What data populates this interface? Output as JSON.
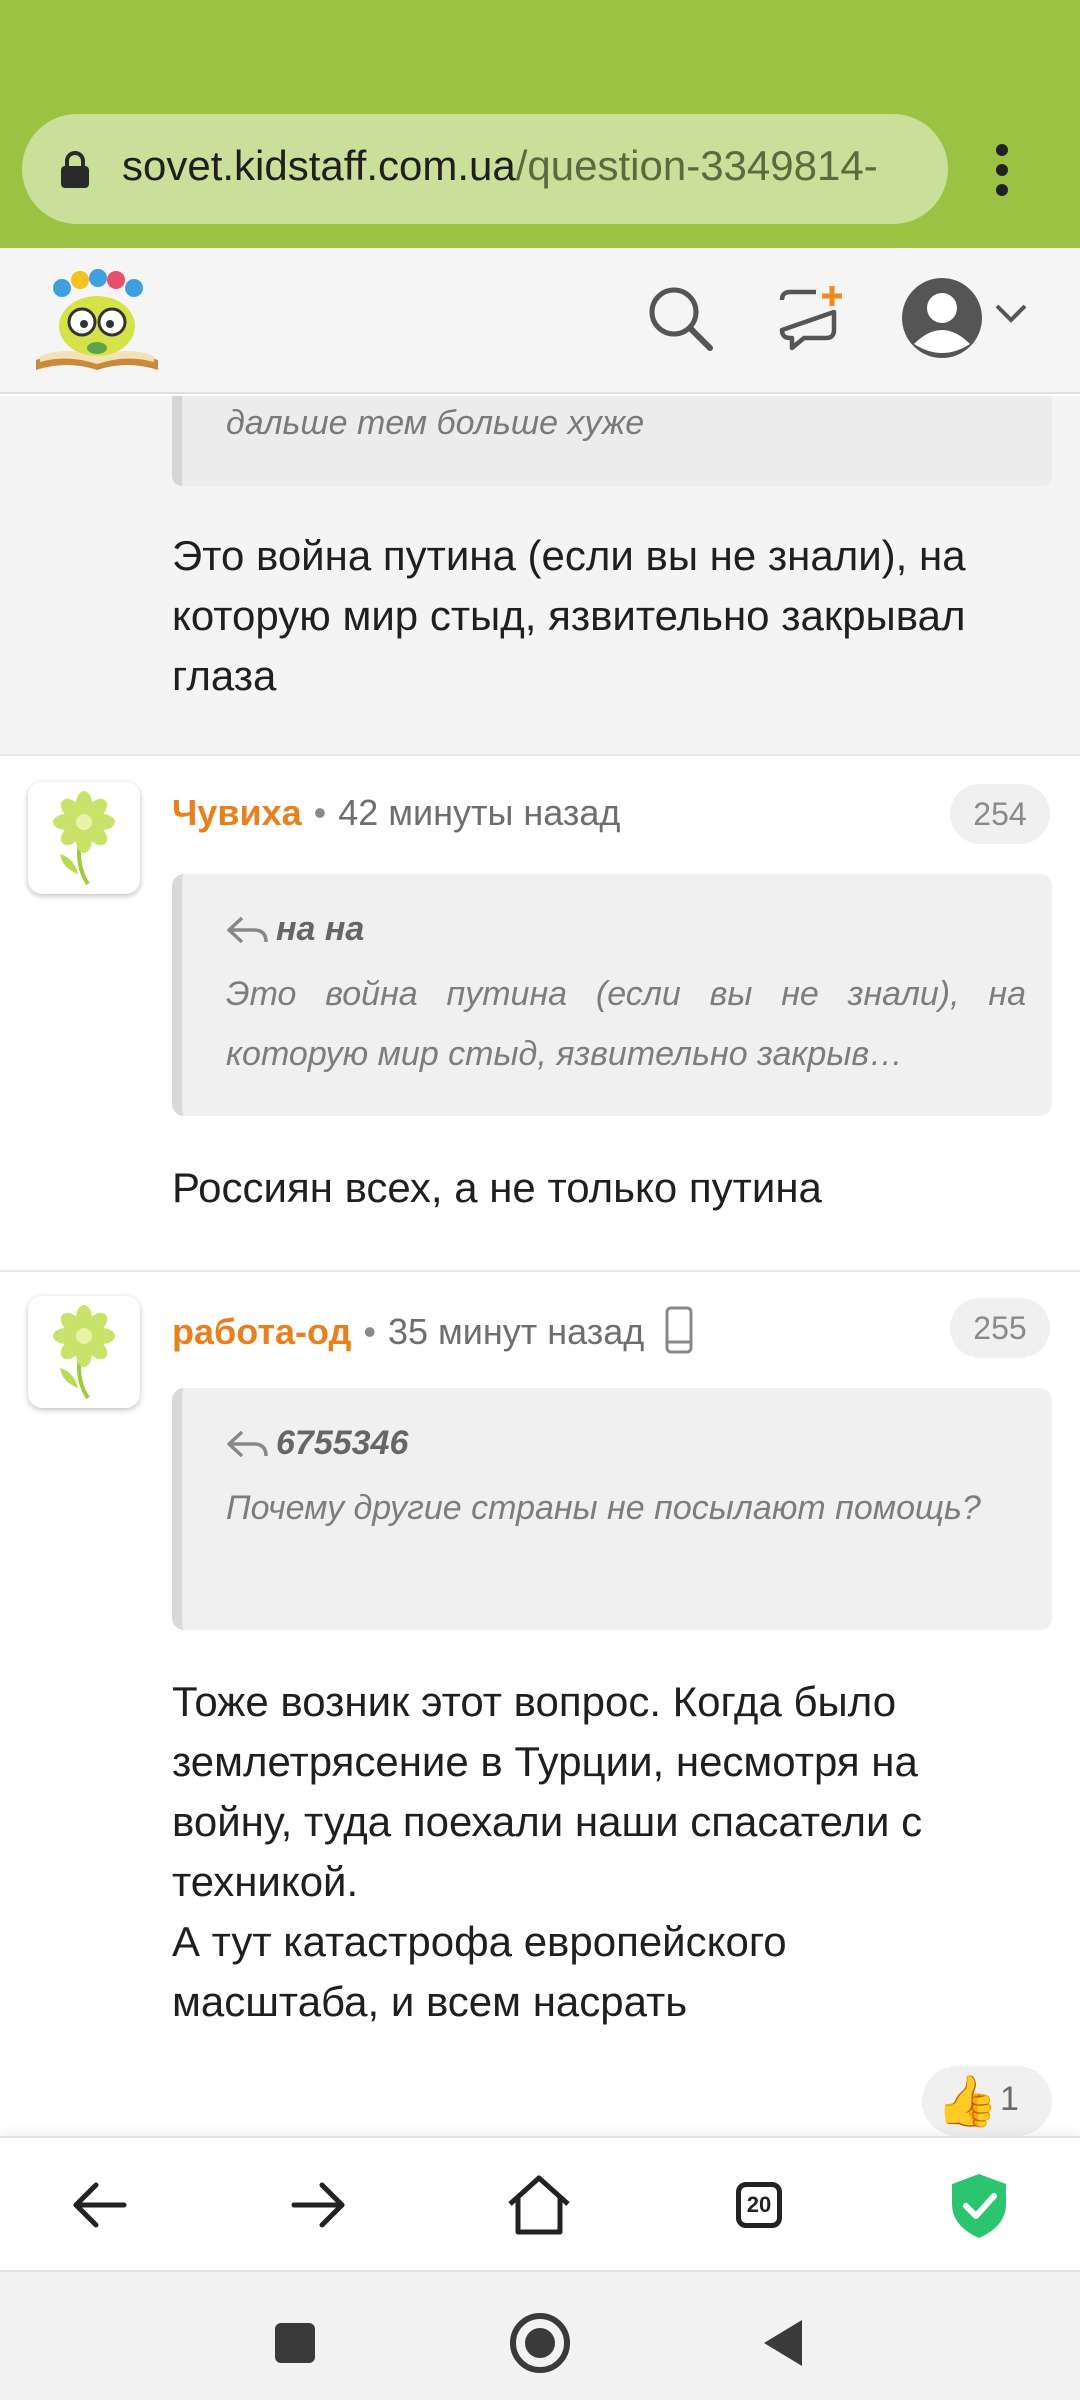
{
  "browser": {
    "url_host": "sovet.kidstaff.com.ua",
    "url_path": "/question-3349814-",
    "colors": {
      "bar": "#9cc244",
      "url_pill": "#c9df9a"
    }
  },
  "header": {
    "icons": [
      "logo",
      "search-icon",
      "new-topic-icon",
      "avatar-icon",
      "chevron-down-icon"
    ]
  },
  "previous_comment": {
    "quote_tail": "дальше тем больше хуже",
    "text": "Это война путина (если вы не знали), на которую мир стыд, язвительно закрывал глаза"
  },
  "comments": [
    {
      "author": "Чувиха",
      "time": "42 минуты назад",
      "number": "254",
      "quote_author": "на на",
      "quote_text": "Это война путина (если вы не знали), на которую мир стыд, язвительно закрыв…",
      "text": "Россиян всех, а не только путина"
    },
    {
      "author": "работа-од",
      "time": "35 минут назад",
      "number": "255",
      "device_icon": "mobile-icon",
      "quote_author": "6755346",
      "quote_text": "Почему другие страны не посылают помощь?",
      "text_lines": [
        "Тоже возник этот вопрос. Когда было",
        "землетрясение в Турции, несмотря на",
        "войну, туда поехали наши спасатели с",
        "техникой.",
        "А тут катастрофа европейского",
        "масштаба, и всем насрать"
      ],
      "likes": "1"
    }
  ],
  "toolbar": {
    "tabs_count": "20",
    "icons": [
      "back-arrow-icon",
      "forward-arrow-icon",
      "home-icon",
      "tabs-icon",
      "shield-check-icon"
    ]
  },
  "system_nav": {
    "icons": [
      "recents-icon",
      "home-circle-icon",
      "back-triangle-icon"
    ]
  }
}
